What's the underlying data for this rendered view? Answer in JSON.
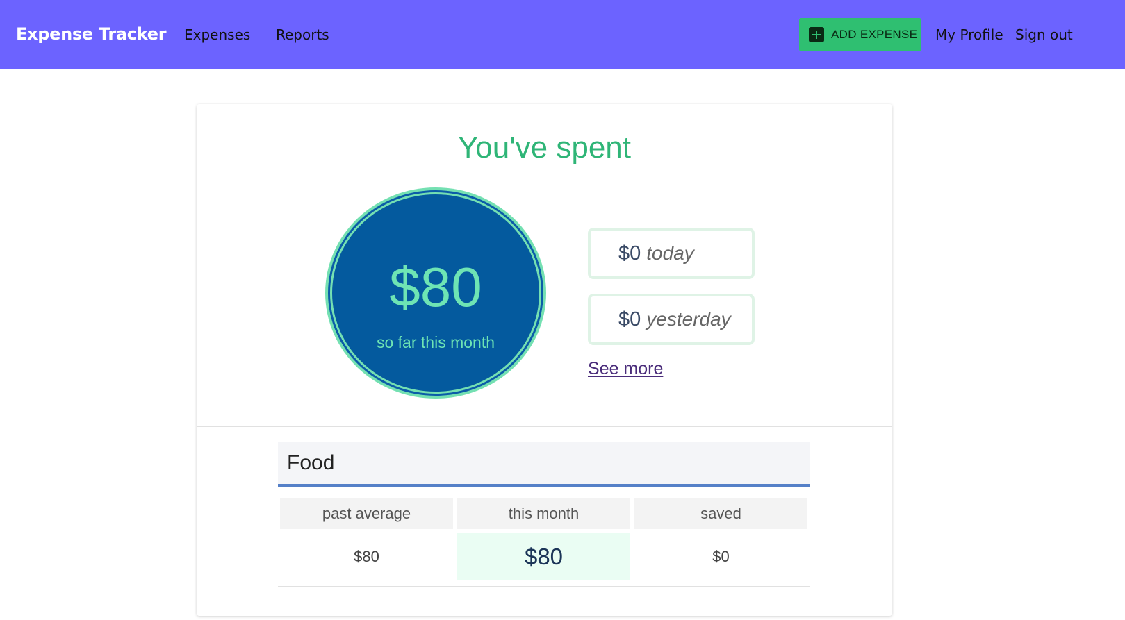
{
  "nav": {
    "brand": "Expense Tracker",
    "links": [
      "Expenses",
      "Reports"
    ],
    "add_button": "ADD EXPENSE",
    "profile": "My Profile",
    "signout": "Sign out",
    "add_button_color": "#2fbf71",
    "bar_color": "#6c63ff"
  },
  "summary": {
    "title": "You've spent",
    "month_amount": "$80",
    "month_caption": "so far this month",
    "today_amount": "$0",
    "today_label": "today",
    "yesterday_amount": "$0",
    "yesterday_label": "yesterday",
    "see_more": "See more"
  },
  "category": {
    "name": "Food",
    "columns": [
      "past average",
      "this month",
      "saved"
    ],
    "values": [
      "$80",
      "$80",
      "$0"
    ]
  }
}
